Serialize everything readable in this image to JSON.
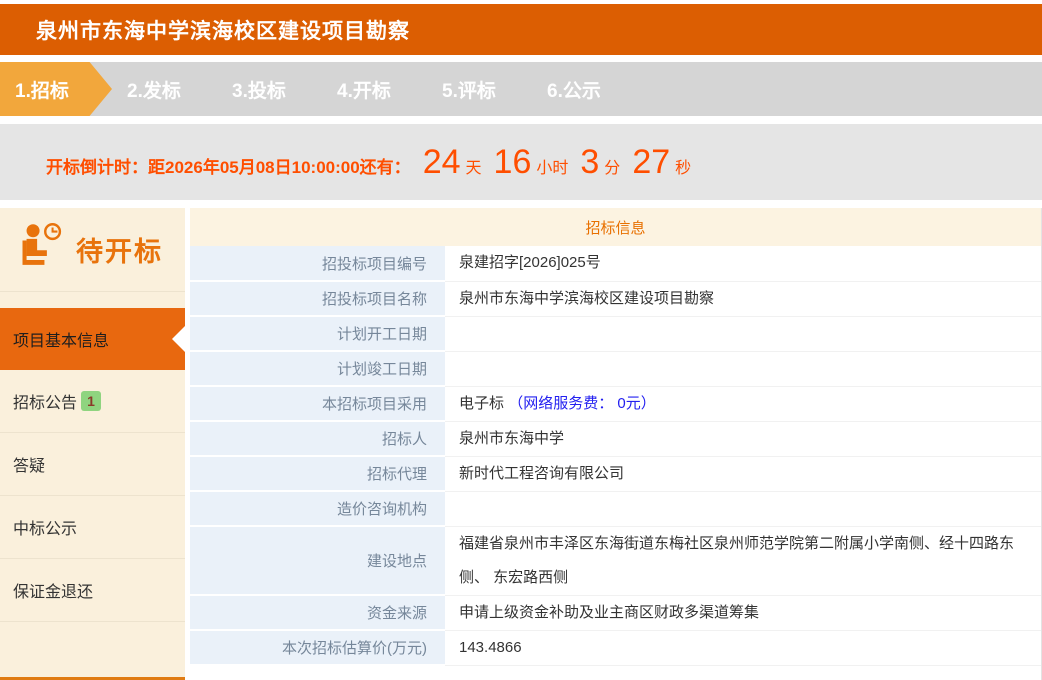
{
  "header": {
    "title": "泉州市东海中学滨海校区建设项目勘察"
  },
  "steps": {
    "items": [
      {
        "label": "1.招标",
        "active": true
      },
      {
        "label": "2.发标",
        "active": false
      },
      {
        "label": "3.投标",
        "active": false
      },
      {
        "label": "4.开标",
        "active": false
      },
      {
        "label": "5.评标",
        "active": false
      },
      {
        "label": "6.公示",
        "active": false
      }
    ]
  },
  "countdown": {
    "prefix": "开标倒计时：",
    "until": "距2026年05月08日10:00:00还有：",
    "days": "24",
    "days_unit": "天",
    "hours": "16",
    "hours_unit": "小时",
    "minutes": "3",
    "minutes_unit": "分",
    "seconds": "27",
    "seconds_unit": "秒"
  },
  "sidebar": {
    "status_label": "待开标",
    "status_icon": "person-waiting-clock-icon",
    "items": [
      {
        "label": "项目基本信息",
        "active": true
      },
      {
        "label": "招标公告",
        "badge": "1"
      },
      {
        "label": "答疑"
      },
      {
        "label": "中标公示"
      },
      {
        "label": "保证金退还"
      }
    ]
  },
  "table": {
    "title": "招标信息",
    "rows": [
      {
        "label": "招投标项目编号",
        "value": "泉建招字[2026]025号"
      },
      {
        "label": "招投标项目名称",
        "value": "泉州市东海中学滨海校区建设项目勘察"
      },
      {
        "label": "计划开工日期",
        "value": ""
      },
      {
        "label": "计划竣工日期",
        "value": ""
      },
      {
        "label": "本招标项目采用",
        "value": "电子标",
        "value_note": "（网络服务费： 0元）"
      },
      {
        "label": "招标人",
        "value": "泉州市东海中学"
      },
      {
        "label": "招标代理",
        "value": "新时代工程咨询有限公司"
      },
      {
        "label": "造价咨询机构",
        "value": ""
      },
      {
        "label": "建设地点",
        "value": "福建省泉州市丰泽区东海街道东梅社区泉州师范学院第二附属小学南侧、经十四路东侧、 东宏路西侧"
      },
      {
        "label": "资金来源",
        "value": "申请上级资金补助及业主商区财政多渠道筹集"
      },
      {
        "label": "本次招标估算价(万元)",
        "value": "143.4866"
      }
    ]
  },
  "colors": {
    "header_orange": "#DC5E02",
    "active_step_orange": "#F2A73C",
    "steps_bar_gray": "#D5D5D5",
    "countdown_gray": "#E5E5E5",
    "countdown_text": "#FF4E00",
    "sidebar_cream": "#FAF0DC",
    "active_menu_orange": "#E8680F",
    "table_header_cream": "#FCF3E1",
    "table_title_orange": "#E87000",
    "label_cell_blue": "#EAF1F9",
    "label_text_gray": "#76879A",
    "badge_green": "#8FD47F",
    "link_blue": "#2320F0"
  }
}
